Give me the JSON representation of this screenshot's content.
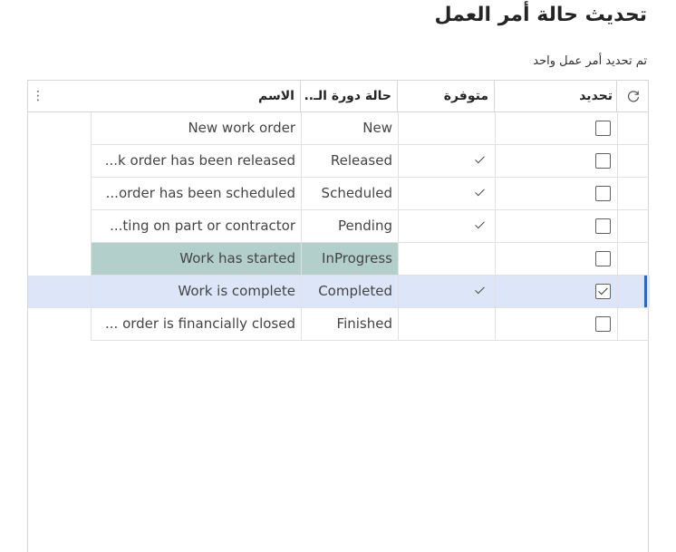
{
  "page": {
    "title": "تحديث حالة أمر العمل",
    "subtitle": "تم تحديد أمر عمل واحد"
  },
  "grid": {
    "headers": {
      "refresh_icon": "refresh-icon",
      "update": "تحديد",
      "available": "متوفرة",
      "lifecycle_state": "حالة دورة الـ..",
      "name": "الاسم",
      "more_icon": "⋮"
    },
    "rows": [
      {
        "name": "New work order",
        "state": "New",
        "available": false,
        "selected": false
      },
      {
        "name": "...k order has been released",
        "state": "Released",
        "available": true,
        "selected": false
      },
      {
        "name": "...order has been scheduled",
        "state": "Scheduled",
        "available": true,
        "selected": false
      },
      {
        "name": "...ting on part or contractor",
        "state": "Pending",
        "available": true,
        "selected": false
      },
      {
        "name": "Work has started",
        "state": "InProgress",
        "available": false,
        "selected": false,
        "highlight": "current"
      },
      {
        "name": "Work is complete",
        "state": "Completed",
        "available": true,
        "selected": true,
        "highlight": "selected"
      },
      {
        "name": "... order is financially closed",
        "state": "Finished",
        "available": false,
        "selected": false
      }
    ]
  },
  "colors": {
    "current_row": "#b3cfcc",
    "selected_row": "#dce6f8",
    "selection_bar": "#2266e3"
  }
}
